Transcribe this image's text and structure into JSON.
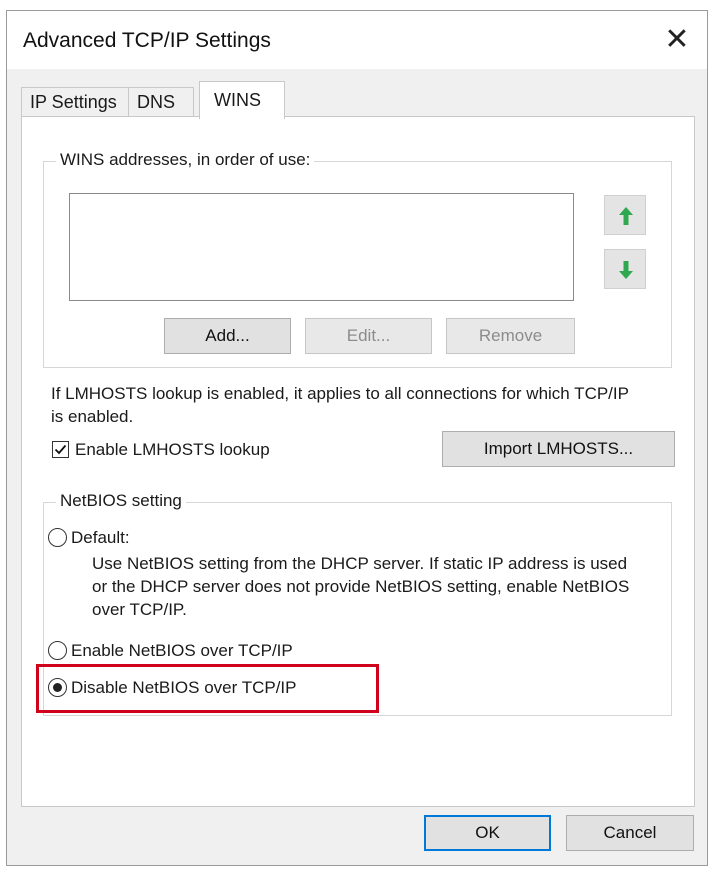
{
  "window": {
    "title": "Advanced TCP/IP Settings",
    "close_glyph": "✕"
  },
  "tabs": [
    {
      "label": "IP Settings",
      "active": false
    },
    {
      "label": "DNS",
      "active": false
    },
    {
      "label": "WINS",
      "active": true
    }
  ],
  "wins": {
    "group_label": "WINS addresses, in order of use:",
    "addresses": [],
    "add_label": "Add...",
    "edit_label": "Edit...",
    "remove_label": "Remove",
    "move_up_icon": "green-arrow-up-icon",
    "move_down_icon": "green-arrow-down-icon"
  },
  "lmhosts": {
    "description": "If LMHOSTS lookup is enabled, it applies to all connections for which TCP/IP is enabled.",
    "checkbox_label": "Enable LMHOSTS lookup",
    "checked": true,
    "import_label": "Import LMHOSTS..."
  },
  "netbios": {
    "group_label": "NetBIOS setting",
    "default_label": "Default:",
    "default_description": "Use NetBIOS setting from the DHCP server. If static IP address is used or the DHCP server does not provide NetBIOS setting, enable NetBIOS over TCP/IP.",
    "enable_label": "Enable NetBIOS over TCP/IP",
    "disable_label": "Disable NetBIOS over TCP/IP",
    "selected": "disable",
    "highlight_color": "#d0021b"
  },
  "footer": {
    "ok_label": "OK",
    "cancel_label": "Cancel"
  },
  "colors": {
    "accent": "#0078d7",
    "arrow_green": "#2fa84f"
  }
}
